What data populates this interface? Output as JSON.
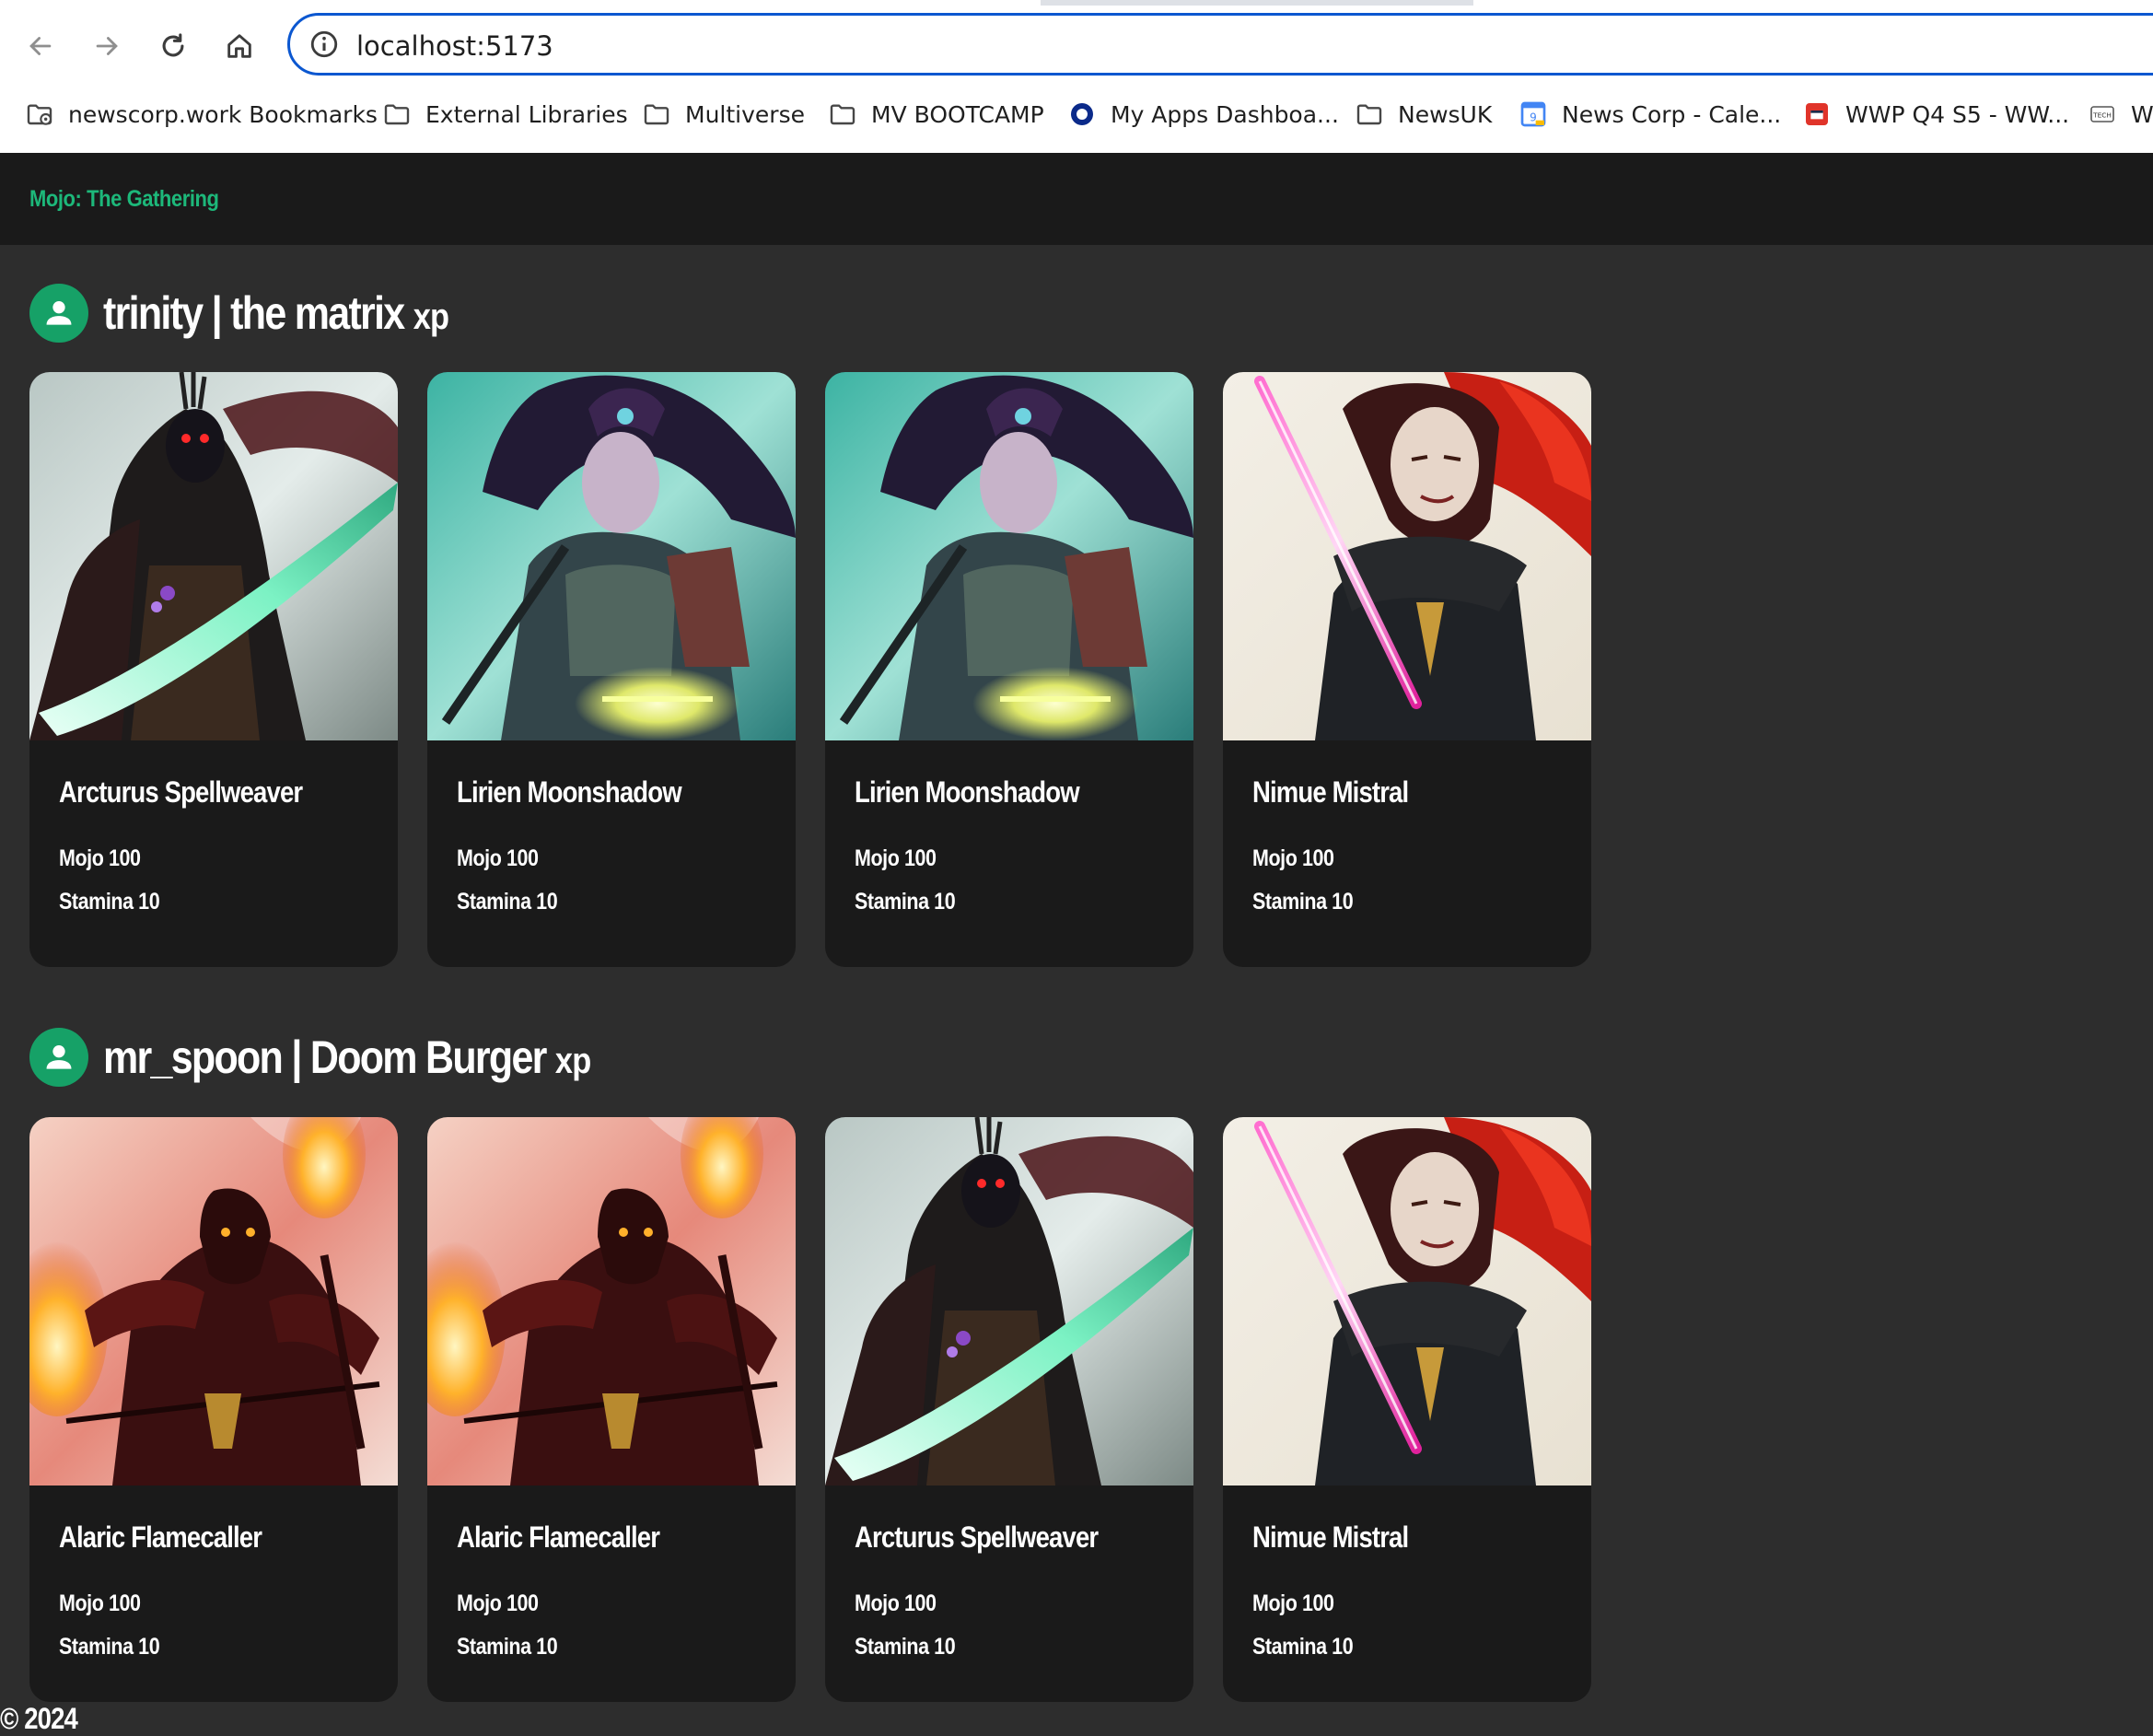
{
  "browser": {
    "url": "localhost:5173",
    "bookmarks": [
      {
        "label": "newscorp.work Bookmarks",
        "icon": "managed-folder-icon"
      },
      {
        "label": "External Libraries",
        "icon": "folder-icon"
      },
      {
        "label": "Multiverse",
        "icon": "folder-icon"
      },
      {
        "label": "MV BOOTCAMP",
        "icon": "folder-icon"
      },
      {
        "label": "My Apps Dashboa...",
        "icon": "ring-logo-icon"
      },
      {
        "label": "NewsUK",
        "icon": "folder-icon"
      },
      {
        "label": "News Corp - Cale...",
        "icon": "calendar-icon"
      },
      {
        "label": "WWP Q4 S5 - WW...",
        "icon": "red-app-icon"
      },
      {
        "label": "We",
        "icon": "tech-icon"
      }
    ]
  },
  "app": {
    "brand": "Mojo: The Gathering",
    "accent": "#1db87a",
    "players": [
      {
        "name": "trinity | the matrix",
        "xp": "xp",
        "cards": [
          {
            "name": "Arcturus Spellweaver",
            "mojo": "Mojo 100",
            "stamina": "Stamina 10",
            "art": "arcturus"
          },
          {
            "name": "Lirien Moonshadow",
            "mojo": "Mojo 100",
            "stamina": "Stamina 10",
            "art": "lirien"
          },
          {
            "name": "Lirien Moonshadow",
            "mojo": "Mojo 100",
            "stamina": "Stamina 10",
            "art": "lirien"
          },
          {
            "name": "Nimue Mistral",
            "mojo": "Mojo 100",
            "stamina": "Stamina 10",
            "art": "nimue"
          }
        ]
      },
      {
        "name": "mr_spoon | Doom Burger",
        "xp": "xp",
        "cards": [
          {
            "name": "Alaric Flamecaller",
            "mojo": "Mojo 100",
            "stamina": "Stamina 10",
            "art": "alaric"
          },
          {
            "name": "Alaric Flamecaller",
            "mojo": "Mojo 100",
            "stamina": "Stamina 10",
            "art": "alaric"
          },
          {
            "name": "Arcturus Spellweaver",
            "mojo": "Mojo 100",
            "stamina": "Stamina 10",
            "art": "arcturus"
          },
          {
            "name": "Nimue Mistral",
            "mojo": "Mojo 100",
            "stamina": "Stamina 10",
            "art": "nimue"
          }
        ]
      }
    ],
    "footer": "© 2024"
  }
}
